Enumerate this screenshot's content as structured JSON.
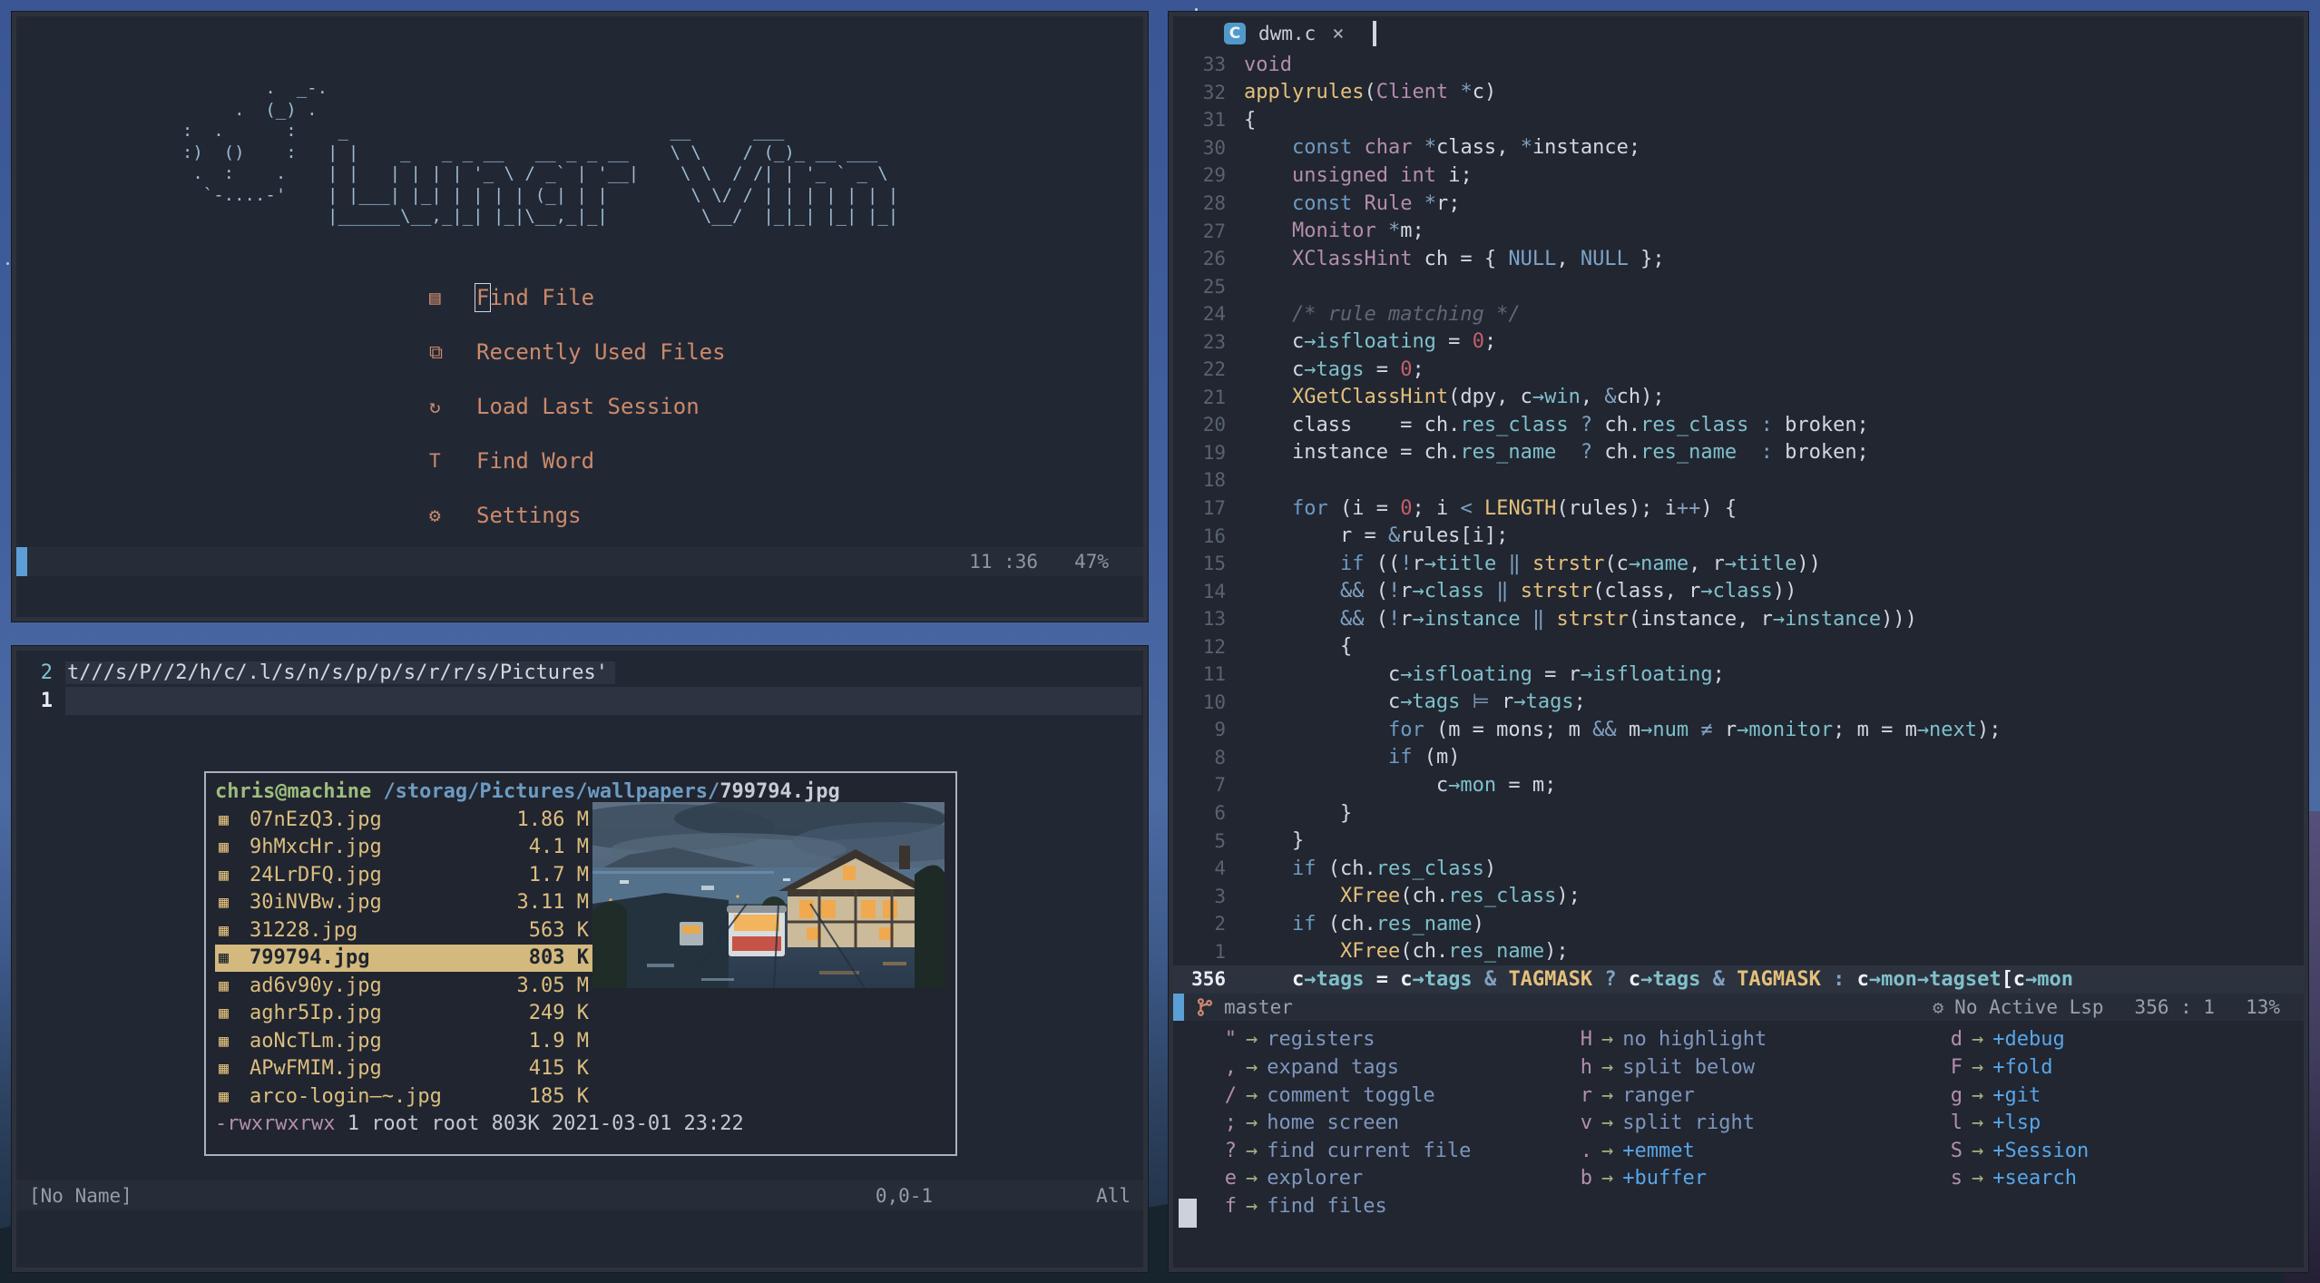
{
  "colors": {
    "accent_blue": "#5c9fd6",
    "menu_salmon": "#cb8a6a",
    "file_tan": "#ddbe7f",
    "branch_orange": "#d08770",
    "ascii_blue": "#9cbcd4"
  },
  "dashboard": {
    "ascii_art": "          .  _-.\n       .  (_) .\n  :  .      :    _                               __      ___\n  :)  ()    :   | |    _   _ _ __   __ _ _ __    \\ \\    / (_)_ __ ___\n   .  :    .    | |   | | | | '_ \\ / _` | '__|    \\ \\  / /| | '_ ` _ \\\n    `-....-'    | |___| |_| | | | | (_| | |        \\ \\/ / | | | | | | |\n                |______\\__,_|_| |_|\\__,_|_|         \\__/  |_|_| |_| |_|",
    "menu": [
      {
        "icon": "▤",
        "label": "Find File",
        "cursor_on_first": true
      },
      {
        "icon": "⧉",
        "label": "Recently Used Files"
      },
      {
        "icon": "↻",
        "label": "Load Last Session"
      },
      {
        "icon": "T",
        "label": "Find Word"
      },
      {
        "icon": "⚙",
        "label": "Settings"
      }
    ],
    "statusline": {
      "position": "11 :36",
      "percent": "47%"
    }
  },
  "terminal": {
    "line2": {
      "num": "2",
      "text": "t///s/P//2/h/c/.l/s/n/s/p/p/s/r/r/s/Pictures'"
    },
    "line1": {
      "num": "1"
    },
    "file_manager": {
      "title_user": "chris@machine",
      "title_sep": " ",
      "title_path": "/storag/Pictures/wallpapers/",
      "title_file": "799794.jpg",
      "file_icon": "▦",
      "files": [
        {
          "name": "07nEzQ3.jpg",
          "size": "1.86 M"
        },
        {
          "name": "9hMxcHr.jpg",
          "size": "4.1 M"
        },
        {
          "name": "24LrDFQ.jpg",
          "size": "1.7 M"
        },
        {
          "name": "30iNVBw.jpg",
          "size": "3.11 M"
        },
        {
          "name": "31228.jpg",
          "size": "563 K"
        },
        {
          "name": "799794.jpg",
          "size": "803 K",
          "selected": true
        },
        {
          "name": "ad6v90y.jpg",
          "size": "3.05 M"
        },
        {
          "name": "aghr5Ip.jpg",
          "size": "249 K"
        },
        {
          "name": "aoNcTLm.jpg",
          "size": "1.9 M"
        },
        {
          "name": "APwFMIM.jpg",
          "size": "415 K"
        },
        {
          "name": "arco-login—~.jpg",
          "size": "185 K"
        }
      ],
      "perms": "-rwxrwxrwx",
      "perms_rest": " 1 root root 803K 2021-03-01 23:22"
    },
    "statusline": {
      "name": "[No Name]",
      "position": "0,0-1",
      "scroll": "All"
    }
  },
  "editor": {
    "tab": {
      "icon": "C",
      "title": "dwm.c",
      "close": "×"
    },
    "code_lines": [
      {
        "n": "33",
        "segs": [
          [
            "void",
            "p"
          ]
        ]
      },
      {
        "n": "32",
        "segs": [
          [
            "applyrules",
            "f"
          ],
          [
            "(",
            "t"
          ],
          [
            "Client",
            "p"
          ],
          [
            " ",
            "t"
          ],
          [
            "*",
            "o"
          ],
          [
            "c",
            "t"
          ],
          [
            ")",
            "t"
          ]
        ]
      },
      {
        "n": "31",
        "segs": [
          [
            "{",
            "t"
          ]
        ]
      },
      {
        "n": "30",
        "segs": [
          [
            "    ",
            "t"
          ],
          [
            "const",
            "b"
          ],
          [
            " ",
            "t"
          ],
          [
            "char",
            "p"
          ],
          [
            " ",
            "t"
          ],
          [
            "*",
            "o"
          ],
          [
            "class",
            "t"
          ],
          [
            ", ",
            "t"
          ],
          [
            "*",
            "o"
          ],
          [
            "instance",
            "t"
          ],
          [
            ";",
            "t"
          ]
        ]
      },
      {
        "n": "29",
        "segs": [
          [
            "    ",
            "t"
          ],
          [
            "unsigned",
            "p"
          ],
          [
            " ",
            "t"
          ],
          [
            "int",
            "p"
          ],
          [
            " i;",
            "t"
          ]
        ]
      },
      {
        "n": "28",
        "segs": [
          [
            "    ",
            "t"
          ],
          [
            "const",
            "b"
          ],
          [
            " ",
            "t"
          ],
          [
            "Rule",
            "p"
          ],
          [
            " ",
            "t"
          ],
          [
            "*",
            "o"
          ],
          [
            "r;",
            "t"
          ]
        ]
      },
      {
        "n": "27",
        "segs": [
          [
            "    ",
            "t"
          ],
          [
            "Monitor",
            "p"
          ],
          [
            " ",
            "t"
          ],
          [
            "*",
            "o"
          ],
          [
            "m;",
            "t"
          ]
        ]
      },
      {
        "n": "26",
        "segs": [
          [
            "    ",
            "t"
          ],
          [
            "XClassHint",
            "p"
          ],
          [
            " ch = { ",
            "t"
          ],
          [
            "NULL",
            "u"
          ],
          [
            ", ",
            "t"
          ],
          [
            "NULL",
            "u"
          ],
          [
            " };",
            "t"
          ]
        ]
      },
      {
        "n": "25",
        "segs": []
      },
      {
        "n": "24",
        "segs": [
          [
            "    ",
            "t"
          ],
          [
            "/* rule matching */",
            "m"
          ]
        ]
      },
      {
        "n": "23",
        "segs": [
          [
            "    c",
            "t"
          ],
          [
            "→isfloating",
            "c"
          ],
          [
            " = ",
            "t"
          ],
          [
            "0",
            "n"
          ],
          [
            ";",
            "t"
          ]
        ]
      },
      {
        "n": "22",
        "segs": [
          [
            "    c",
            "t"
          ],
          [
            "→tags",
            "c"
          ],
          [
            " = ",
            "t"
          ],
          [
            "0",
            "n"
          ],
          [
            ";",
            "t"
          ]
        ]
      },
      {
        "n": "21",
        "segs": [
          [
            "    ",
            "t"
          ],
          [
            "XGetClassHint",
            "f"
          ],
          [
            "(dpy, c",
            "t"
          ],
          [
            "→win",
            "c"
          ],
          [
            ", ",
            "t"
          ],
          [
            "&",
            "o"
          ],
          [
            "ch);",
            "t"
          ]
        ]
      },
      {
        "n": "20",
        "segs": [
          [
            "    class    = ch.",
            "t"
          ],
          [
            "res_class",
            "c"
          ],
          [
            " ",
            "t"
          ],
          [
            "?",
            "o"
          ],
          [
            " ch.",
            "t"
          ],
          [
            "res_class",
            "c"
          ],
          [
            " ",
            "t"
          ],
          [
            ":",
            "o"
          ],
          [
            " broken;",
            "t"
          ]
        ]
      },
      {
        "n": "19",
        "segs": [
          [
            "    instance = ch.",
            "t"
          ],
          [
            "res_name",
            "c"
          ],
          [
            "  ",
            "t"
          ],
          [
            "?",
            "o"
          ],
          [
            " ch.",
            "t"
          ],
          [
            "res_name",
            "c"
          ],
          [
            "  ",
            "t"
          ],
          [
            ":",
            "o"
          ],
          [
            " broken;",
            "t"
          ]
        ]
      },
      {
        "n": "18",
        "segs": []
      },
      {
        "n": "17",
        "segs": [
          [
            "    ",
            "t"
          ],
          [
            "for",
            "b"
          ],
          [
            " (i = ",
            "t"
          ],
          [
            "0",
            "n"
          ],
          [
            "; i ",
            "t"
          ],
          [
            "<",
            "o"
          ],
          [
            " ",
            "t"
          ],
          [
            "LENGTH",
            "f"
          ],
          [
            "(rules); i",
            "t"
          ],
          [
            "++",
            "o"
          ],
          [
            ") {",
            "t"
          ]
        ]
      },
      {
        "n": "16",
        "segs": [
          [
            "        r = ",
            "t"
          ],
          [
            "&",
            "o"
          ],
          [
            "rules[i];",
            "t"
          ]
        ]
      },
      {
        "n": "15",
        "segs": [
          [
            "        ",
            "t"
          ],
          [
            "if",
            "b"
          ],
          [
            " ((",
            "t"
          ],
          [
            "!",
            "o"
          ],
          [
            "r",
            "t"
          ],
          [
            "→title",
            "c"
          ],
          [
            " ",
            "t"
          ],
          [
            "‖",
            "o"
          ],
          [
            " ",
            "t"
          ],
          [
            "strstr",
            "f"
          ],
          [
            "(c",
            "t"
          ],
          [
            "→name",
            "c"
          ],
          [
            ", r",
            "t"
          ],
          [
            "→title",
            "c"
          ],
          [
            "))",
            "t"
          ]
        ]
      },
      {
        "n": "14",
        "segs": [
          [
            "        ",
            "t"
          ],
          [
            "&&",
            "o"
          ],
          [
            " (",
            "t"
          ],
          [
            "!",
            "o"
          ],
          [
            "r",
            "t"
          ],
          [
            "→class",
            "c"
          ],
          [
            " ",
            "t"
          ],
          [
            "‖",
            "o"
          ],
          [
            " ",
            "t"
          ],
          [
            "strstr",
            "f"
          ],
          [
            "(class, r",
            "t"
          ],
          [
            "→class",
            "c"
          ],
          [
            "))",
            "t"
          ]
        ]
      },
      {
        "n": "13",
        "segs": [
          [
            "        ",
            "t"
          ],
          [
            "&&",
            "o"
          ],
          [
            " (",
            "t"
          ],
          [
            "!",
            "o"
          ],
          [
            "r",
            "t"
          ],
          [
            "→instance",
            "c"
          ],
          [
            " ",
            "t"
          ],
          [
            "‖",
            "o"
          ],
          [
            " ",
            "t"
          ],
          [
            "strstr",
            "f"
          ],
          [
            "(instance, r",
            "t"
          ],
          [
            "→instance",
            "c"
          ],
          [
            ")))",
            "t"
          ]
        ]
      },
      {
        "n": "12",
        "segs": [
          [
            "        {",
            "t"
          ]
        ]
      },
      {
        "n": "11",
        "segs": [
          [
            "            c",
            "t"
          ],
          [
            "→isfloating",
            "c"
          ],
          [
            " = r",
            "t"
          ],
          [
            "→isfloating",
            "c"
          ],
          [
            ";",
            "t"
          ]
        ]
      },
      {
        "n": "10",
        "segs": [
          [
            "            c",
            "t"
          ],
          [
            "→tags",
            "c"
          ],
          [
            " ",
            "t"
          ],
          [
            "⊨",
            "o"
          ],
          [
            " r",
            "t"
          ],
          [
            "→tags",
            "c"
          ],
          [
            ";",
            "t"
          ]
        ]
      },
      {
        "n": "9",
        "segs": [
          [
            "            ",
            "t"
          ],
          [
            "for",
            "b"
          ],
          [
            " (m = mons; m ",
            "t"
          ],
          [
            "&&",
            "o"
          ],
          [
            " m",
            "t"
          ],
          [
            "→num",
            "c"
          ],
          [
            " ",
            "t"
          ],
          [
            "≠",
            "o"
          ],
          [
            " r",
            "t"
          ],
          [
            "→monitor",
            "c"
          ],
          [
            "; m = m",
            "t"
          ],
          [
            "→next",
            "c"
          ],
          [
            ");",
            "t"
          ]
        ]
      },
      {
        "n": "8",
        "segs": [
          [
            "            ",
            "t"
          ],
          [
            "if",
            "b"
          ],
          [
            " (m)",
            "t"
          ]
        ]
      },
      {
        "n": "7",
        "segs": [
          [
            "                c",
            "t"
          ],
          [
            "→mon",
            "c"
          ],
          [
            " = m;",
            "t"
          ]
        ]
      },
      {
        "n": "6",
        "segs": [
          [
            "        }",
            "t"
          ]
        ]
      },
      {
        "n": "5",
        "segs": [
          [
            "    }",
            "t"
          ]
        ]
      },
      {
        "n": "4",
        "segs": [
          [
            "    ",
            "t"
          ],
          [
            "if",
            "b"
          ],
          [
            " (ch.",
            "t"
          ],
          [
            "res_class",
            "c"
          ],
          [
            ")",
            "t"
          ]
        ]
      },
      {
        "n": "3",
        "segs": [
          [
            "        ",
            "t"
          ],
          [
            "XFree",
            "f"
          ],
          [
            "(ch.",
            "t"
          ],
          [
            "res_class",
            "c"
          ],
          [
            ");",
            "t"
          ]
        ]
      },
      {
        "n": "2",
        "segs": [
          [
            "    ",
            "t"
          ],
          [
            "if",
            "b"
          ],
          [
            " (ch.",
            "t"
          ],
          [
            "res_name",
            "c"
          ],
          [
            ")",
            "t"
          ]
        ]
      },
      {
        "n": "1",
        "segs": [
          [
            "        ",
            "t"
          ],
          [
            "XFree",
            "f"
          ],
          [
            "(ch.",
            "t"
          ],
          [
            "res_name",
            "c"
          ],
          [
            ");",
            "t"
          ]
        ]
      },
      {
        "n": "356",
        "current": true,
        "segs": [
          [
            "    c",
            "t"
          ],
          [
            "→tags",
            "c"
          ],
          [
            " = c",
            "t"
          ],
          [
            "→tags",
            "c"
          ],
          [
            " ",
            "t"
          ],
          [
            "&",
            "o"
          ],
          [
            " ",
            "t"
          ],
          [
            "TAGMASK",
            "f"
          ],
          [
            " ",
            "t"
          ],
          [
            "?",
            "o"
          ],
          [
            " c",
            "t"
          ],
          [
            "→tags",
            "c"
          ],
          [
            " ",
            "t"
          ],
          [
            "&",
            "o"
          ],
          [
            " ",
            "t"
          ],
          [
            "TAGMASK",
            "f"
          ],
          [
            " ",
            "t"
          ],
          [
            ":",
            "o"
          ],
          [
            " c",
            "t"
          ],
          [
            "→mon",
            "c"
          ],
          [
            "→tagset",
            "c"
          ],
          [
            "[c",
            "t"
          ],
          [
            "→mon",
            "c"
          ]
        ]
      }
    ],
    "statusline": {
      "branch": "master",
      "lsp_icon": "⚙",
      "lsp": "No Active Lsp",
      "position": "356 : 1",
      "percent": "13%"
    },
    "whichkey": {
      "arrow": "→",
      "cols": [
        [
          {
            "key": "\"",
            "label": "registers"
          },
          {
            "key": ",",
            "label": "expand tags"
          },
          {
            "key": "/",
            "label": "comment toggle"
          },
          {
            "key": ";",
            "label": "home screen"
          },
          {
            "key": "?",
            "label": "find current file"
          },
          {
            "key": "e",
            "label": "explorer"
          },
          {
            "key": "f",
            "label": "find files"
          }
        ],
        [
          {
            "key": "H",
            "label": "no highlight"
          },
          {
            "key": "h",
            "label": "split below"
          },
          {
            "key": "r",
            "label": "ranger"
          },
          {
            "key": "v",
            "label": "split right"
          },
          {
            "key": ".",
            "label": "+emmet",
            "group": true
          },
          {
            "key": "b",
            "label": "+buffer",
            "group": true
          }
        ],
        [
          {
            "key": "d",
            "label": "+debug",
            "group": true
          },
          {
            "key": "F",
            "label": "+fold",
            "group": true
          },
          {
            "key": "g",
            "label": "+git",
            "group": true
          },
          {
            "key": "l",
            "label": "+lsp",
            "group": true
          },
          {
            "key": "S",
            "label": "+Session",
            "group": true
          },
          {
            "key": "s",
            "label": "+search",
            "group": true
          }
        ]
      ]
    }
  }
}
